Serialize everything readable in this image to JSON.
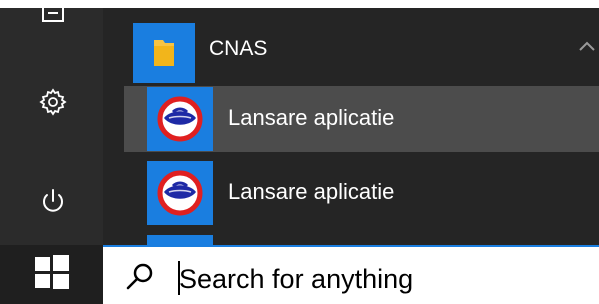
{
  "start_menu": {
    "group": {
      "label": "CNAS",
      "icon": "folder-icon",
      "expanded": true
    },
    "apps": [
      {
        "label": "Lansare aplicatie",
        "icon": "cnas-logo-icon",
        "hovered": true
      },
      {
        "label": "Lansare aplicatie",
        "icon": "cnas-logo-icon",
        "hovered": false
      }
    ],
    "rail": [
      {
        "icon": "document-icon"
      },
      {
        "icon": "gear-icon"
      },
      {
        "icon": "power-icon"
      }
    ]
  },
  "taskbar": {
    "start_icon": "windows-logo-icon",
    "search": {
      "icon": "search-icon",
      "placeholder": "Search for anything"
    }
  },
  "colors": {
    "accent": "#1a7ee0",
    "menu_bg": "#252525",
    "rail_bg": "#2b2b2b",
    "hover_bg": "#4c4c4c",
    "taskbar_bg": "#1f1f1f"
  }
}
